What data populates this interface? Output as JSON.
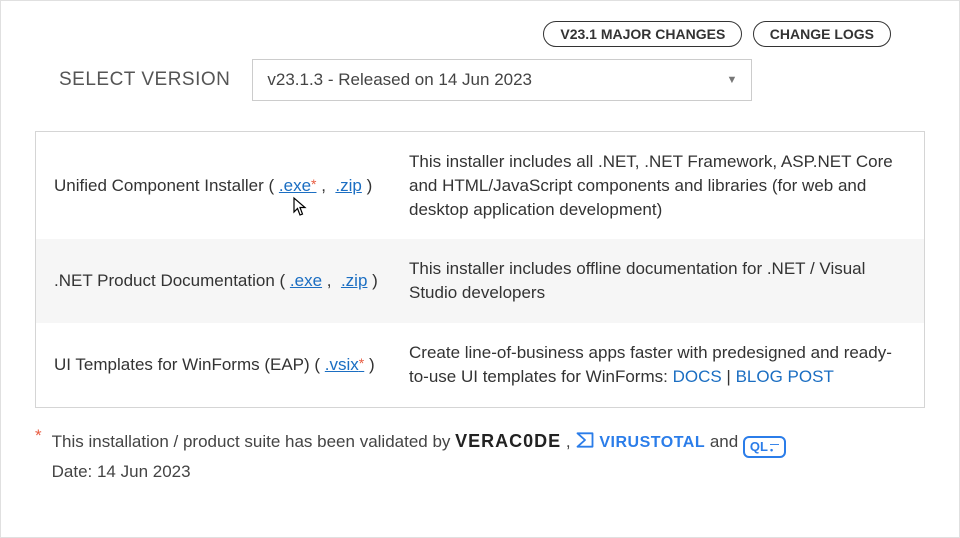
{
  "topButtons": {
    "majorChanges": "V23.1 MAJOR CHANGES",
    "changeLogs": "CHANGE LOGS"
  },
  "versionSelector": {
    "label": "SELECT VERSION",
    "selected": "v23.1.3 - Released on 14 Jun 2023"
  },
  "rows": [
    {
      "name": "Unified Component Installer",
      "links": {
        "exe": ".exe",
        "exeStar": "*",
        "zip": ".zip"
      },
      "desc": "This installer includes all .NET, .NET Framework, ASP.NET Core and HTML/JavaScript components and libraries (for web and desktop application development)"
    },
    {
      "name": ".NET Product Documentation",
      "links": {
        "exe": ".exe",
        "zip": ".zip"
      },
      "desc": "This installer includes offline documentation for .NET / Visual Studio developers"
    },
    {
      "name": "UI Templates for WinForms (EAP)",
      "links": {
        "vsix": ".vsix",
        "vsixStar": "*"
      },
      "descPrefix": "Create line-of-business apps faster with predesigned and ready-to-use UI templates for WinForms: ",
      "docs": "DOCS",
      "sep": " | ",
      "blog": "BLOG POST"
    }
  ],
  "footnote": {
    "text": "This installation / product suite has been validated by ",
    "veracode": "VERAC0DE",
    "comma": " , ",
    "virustotal": "VIRUSTOTAL",
    "and": " and ",
    "ql": "QL",
    "dateLabel": "Date: 14 Jun 2023"
  }
}
